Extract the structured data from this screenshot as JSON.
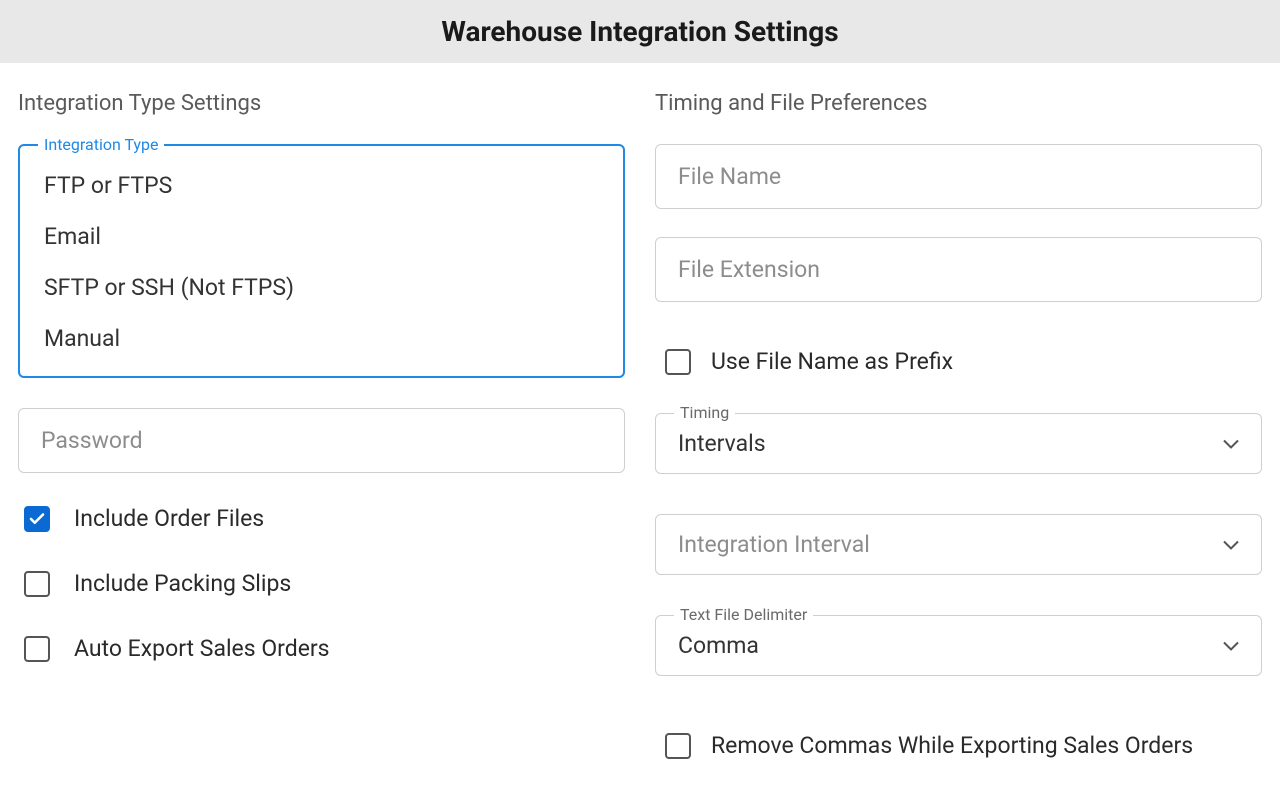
{
  "header": {
    "title": "Warehouse Integration Settings"
  },
  "left": {
    "section_title": "Integration Type Settings",
    "integration_type": {
      "legend": "Integration Type",
      "options": [
        "FTP or FTPS",
        "Email",
        "SFTP or SSH (Not FTPS)",
        "Manual"
      ]
    },
    "password": {
      "placeholder": "Password"
    },
    "checkboxes": {
      "include_order_files": {
        "label": "Include Order Files",
        "checked": true
      },
      "include_packing_slips": {
        "label": "Include Packing Slips",
        "checked": false
      },
      "auto_export_sales_orders": {
        "label": "Auto Export Sales Orders",
        "checked": false
      }
    }
  },
  "right": {
    "section_title": "Timing and File Preferences",
    "file_name": {
      "placeholder": "File Name"
    },
    "file_extension": {
      "placeholder": "File Extension"
    },
    "use_file_name_prefix": {
      "label": "Use File Name as Prefix",
      "checked": false
    },
    "timing": {
      "legend": "Timing",
      "value": "Intervals"
    },
    "integration_interval": {
      "placeholder": "Integration Interval"
    },
    "text_file_delimiter": {
      "legend": "Text File Delimiter",
      "value": "Comma"
    },
    "remove_commas": {
      "label": "Remove Commas While Exporting Sales Orders",
      "checked": false
    }
  }
}
